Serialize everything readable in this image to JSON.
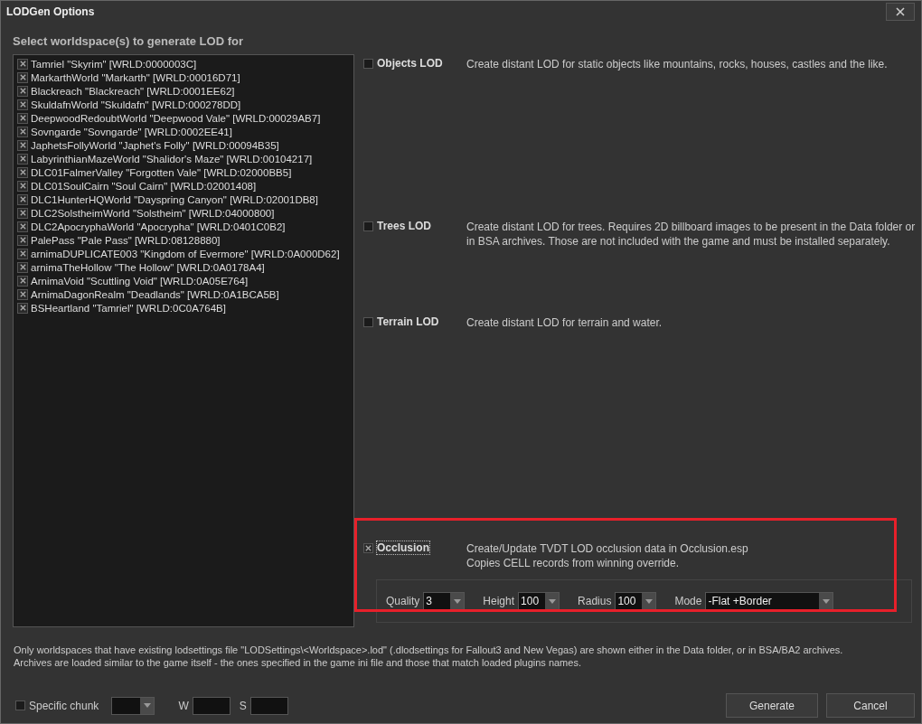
{
  "window": {
    "title": "LODGen Options"
  },
  "worldspaces": {
    "heading": "Select worldspace(s) to generate LOD for",
    "items": [
      {
        "label": "Tamriel \"Skyrim\" [WRLD:0000003C]",
        "checked": true
      },
      {
        "label": "MarkarthWorld \"Markarth\" [WRLD:00016D71]",
        "checked": true
      },
      {
        "label": "Blackreach \"Blackreach\" [WRLD:0001EE62]",
        "checked": true
      },
      {
        "label": "SkuldafnWorld \"Skuldafn\" [WRLD:000278DD]",
        "checked": true
      },
      {
        "label": "DeepwoodRedoubtWorld \"Deepwood Vale\" [WRLD:00029AB7]",
        "checked": true
      },
      {
        "label": "Sovngarde \"Sovngarde\" [WRLD:0002EE41]",
        "checked": true
      },
      {
        "label": "JaphetsFollyWorld \"Japhet's Folly\" [WRLD:00094B35]",
        "checked": true
      },
      {
        "label": "LabyrinthianMazeWorld \"Shalidor's Maze\" [WRLD:00104217]",
        "checked": true
      },
      {
        "label": "DLC01FalmerValley \"Forgotten Vale\" [WRLD:02000BB5]",
        "checked": true
      },
      {
        "label": "DLC01SoulCairn \"Soul Cairn\" [WRLD:02001408]",
        "checked": true
      },
      {
        "label": "DLC1HunterHQWorld \"Dayspring Canyon\" [WRLD:02001DB8]",
        "checked": true
      },
      {
        "label": "DLC2SolstheimWorld \"Solstheim\" [WRLD:04000800]",
        "checked": true
      },
      {
        "label": "DLC2ApocryphaWorld \"Apocrypha\" [WRLD:0401C0B2]",
        "checked": true
      },
      {
        "label": "PalePass \"Pale Pass\" [WRLD:08128880]",
        "checked": true
      },
      {
        "label": "arnimaDUPLICATE003 \"Kingdom of Evermore\" [WRLD:0A000D62]",
        "checked": true
      },
      {
        "label": "arnimaTheHollow \"The Hollow\" [WRLD:0A0178A4]",
        "checked": true
      },
      {
        "label": "ArnimaVoid \"Scuttling Void\" [WRLD:0A05E764]",
        "checked": true
      },
      {
        "label": "ArnimaDagonRealm \"Deadlands\" [WRLD:0A1BCA5B]",
        "checked": true
      },
      {
        "label": "BSHeartland \"Tamriel\" [WRLD:0C0A764B]",
        "checked": true
      }
    ]
  },
  "lod_options": [
    {
      "label": "Objects LOD",
      "checked": false,
      "description": [
        "Create distant LOD for static objects like mountains, rocks, houses, castles and the like."
      ]
    },
    {
      "label": "Trees LOD",
      "checked": false,
      "description": [
        "Create distant LOD for trees. Requires 2D billboard images to be present in the Data folder or in BSA archives. Those are not included with the game and must be installed separately."
      ]
    },
    {
      "label": "Terrain LOD",
      "checked": false,
      "description": [
        "Create distant LOD for terrain and water."
      ]
    },
    {
      "label": "Occlusion",
      "checked": true,
      "focused": true,
      "highlighted": true,
      "description": [
        "Create/Update TVDT LOD occlusion data in Occlusion.esp",
        "Copies CELL records from winning override."
      ],
      "settings": [
        {
          "label": "Quality",
          "value": "3"
        },
        {
          "label": "Height",
          "value": "100"
        },
        {
          "label": "Radius",
          "value": "100"
        },
        {
          "label": "Mode",
          "value": "-Flat +Border"
        }
      ]
    }
  ],
  "note": [
    "Only worldspaces that have existing lodsettings file \"LODSettings\\<Worldspace>.lod\" (.dlodsettings for Fallout3 and New Vegas) are shown either in the Data folder, or in BSA/BA2 archives.",
    "Archives are loaded similar to the game itself - the ones specified in the game ini file and those that match loaded plugins names."
  ],
  "chunk": {
    "label": "Specific chunk",
    "checked": false,
    "w_label": "W",
    "s_label": "S"
  },
  "buttons": [
    "Generate",
    "Cancel"
  ]
}
